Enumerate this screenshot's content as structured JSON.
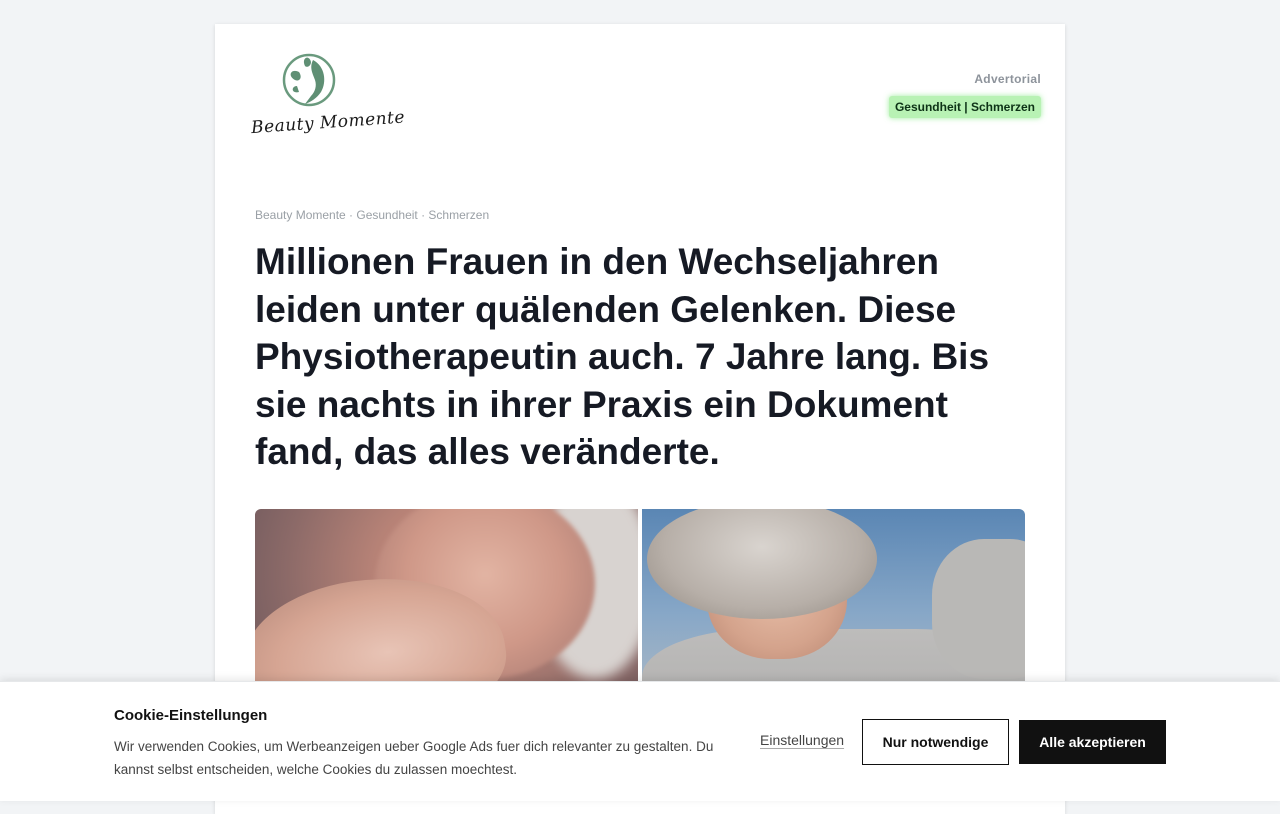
{
  "header": {
    "logo_text": "Beauty Momente",
    "advertorial_label": "Advertorial",
    "category_tag": "Gesundheit | Schmerzen"
  },
  "article": {
    "breadcrumb": "Beauty Momente · Gesundheit · Schmerzen",
    "headline": "Millionen Frauen in den Wechseljahren leiden unter quälenden Gelenken. Diese Physiotherapeutin auch. 7 Jahre lang. Bis sie nachts in ihrer Praxis ein Dokument fand, das alles veränderte."
  },
  "cookie_banner": {
    "title": "Cookie-Einstellungen",
    "text": "Wir verwenden Cookies, um Werbeanzeigen ueber Google Ads fuer dich relevanter zu gestalten. Du kannst selbst entscheiden, welche Cookies du zulassen moechtest.",
    "settings_label": "Einstellungen",
    "necessary_label": "Nur notwendige",
    "accept_label": "Alle akzeptieren"
  },
  "colors": {
    "background": "#f2f4f6",
    "tag_background": "#b8f2b4",
    "headline": "#161a24",
    "logo_green": "#6a9a7e",
    "accept_button": "#111111"
  }
}
